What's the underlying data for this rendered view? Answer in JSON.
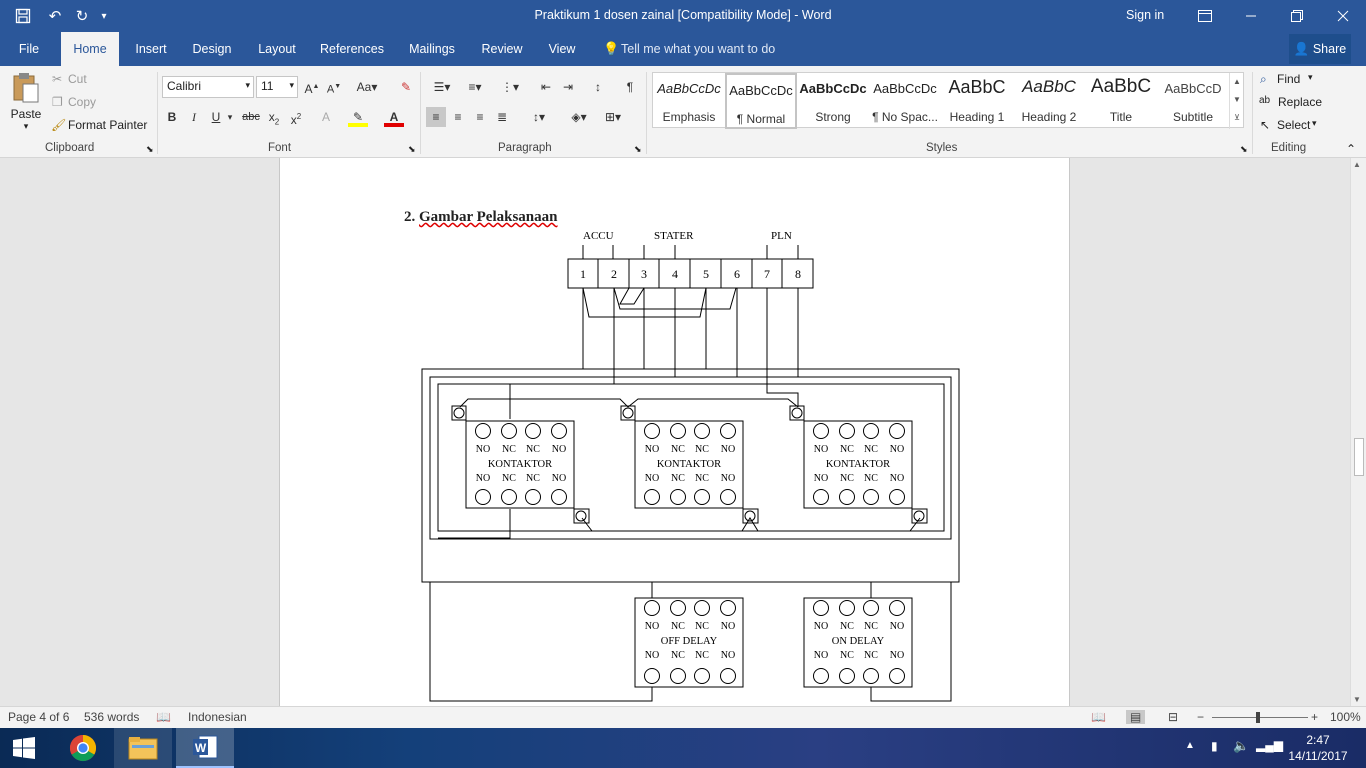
{
  "window": {
    "title": "Praktikum 1 dosen zainal [Compatibility Mode]  -  Word",
    "signin": "Sign in"
  },
  "tabs": [
    "File",
    "Home",
    "Insert",
    "Design",
    "Layout",
    "References",
    "Mailings",
    "Review",
    "View"
  ],
  "tell_me": "Tell me what you want to do",
  "share": "Share",
  "clipboard": {
    "paste": "Paste",
    "cut": "Cut",
    "copy": "Copy",
    "format_painter": "Format Painter",
    "label": "Clipboard"
  },
  "font": {
    "name": "Calibri",
    "size": "11",
    "label": "Font"
  },
  "paragraph": {
    "label": "Paragraph"
  },
  "styles": {
    "label": "Styles",
    "items": [
      {
        "preview": "AaBbCcDc",
        "name": "Emphasis"
      },
      {
        "preview": "AaBbCcDc",
        "name": "¶ Normal"
      },
      {
        "preview": "AaBbCcDc",
        "name": "Strong"
      },
      {
        "preview": "AaBbCcDc",
        "name": "¶ No Spac..."
      },
      {
        "preview": "AaBbC",
        "name": "Heading 1"
      },
      {
        "preview": "AaBbC",
        "name": "Heading 2"
      },
      {
        "preview": "AaBbC",
        "name": "Title"
      },
      {
        "preview": "AaBbCcD",
        "name": "Subtitle"
      }
    ]
  },
  "editing": {
    "find": "Find",
    "replace": "Replace",
    "select": "Select",
    "label": "Editing"
  },
  "document": {
    "heading_num": "2.",
    "heading_text": "Gambar Pelaksanaan",
    "diagram": {
      "top_labels": [
        "ACCU",
        "STATER",
        "PLN"
      ],
      "terminals": [
        "1",
        "2",
        "3",
        "4",
        "5",
        "6",
        "7",
        "8"
      ],
      "contact_row": [
        "NO",
        "NC",
        "NC",
        "NO"
      ],
      "kontaktor": "KONTAKTOR",
      "off_delay": "OFF DELAY",
      "on_delay": "ON DELAY"
    }
  },
  "status": {
    "page": "Page 4 of 6",
    "words": "536 words",
    "language": "Indonesian",
    "zoom": "100%"
  },
  "taskbar": {
    "time": "2:47",
    "date": "14/11/2017"
  }
}
